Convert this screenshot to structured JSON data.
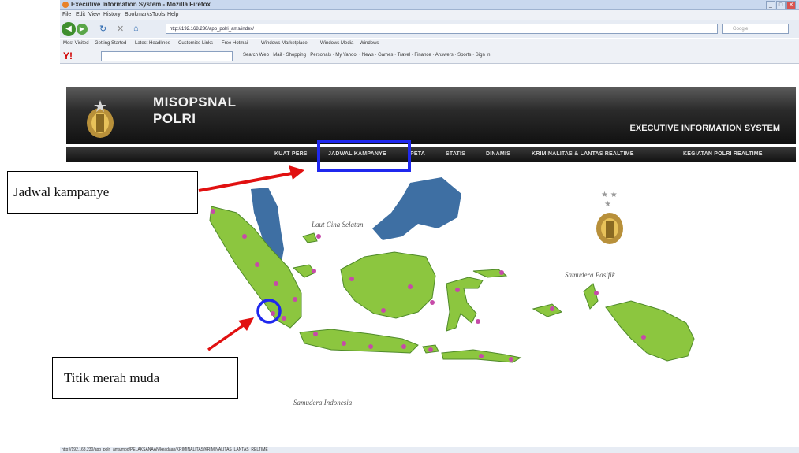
{
  "browser": {
    "title": "Executive Information System - Mozilla Firefox",
    "menu": [
      "File",
      "Edit",
      "View",
      "History",
      "Bookmarks",
      "Tools",
      "Help"
    ],
    "url": "http://192.168.230/app_polri_ams/index/",
    "search_placeholder": "Google",
    "bookmarks": [
      "Most Visited",
      "Getting Started",
      "Latest Headlines",
      "Customize Links",
      "Free Hotmail",
      "Windows Marketplace",
      "Windows Media",
      "Windows"
    ],
    "yahoo_items": "Search Web · Mail · Shopping · Personals · My Yahoo! · News · Games · Travel · Finance · Answers · Sports · Sign In",
    "status_url": "http://192.168.230/app_polri_ams/mod/PELAKSANAAN/keadaan/KRIMINALITAS/KRIMINALITAS_LANTAS_RELTIME"
  },
  "header": {
    "title_line1": "MISOPSNAL",
    "title_line2": "POLRI",
    "subtitle": "EXECUTIVE INFORMATION SYSTEM"
  },
  "nav": {
    "items": [
      "KUAT PERS",
      "JADWAL KAMPANYE",
      "PETA",
      "STATIS",
      "DINAMIS",
      "KRIMINALITAS & LANTAS REALTIME",
      "KEGIATAN POLRI REALTIME"
    ]
  },
  "map": {
    "labels": [
      "Laut Cina Selatan",
      "Samudera Pasifik",
      "Samudera Indonesia"
    ],
    "colors": {
      "land": "#8cc63f",
      "land_dark": "#4f8a2a",
      "sea_fill": "#3e6fa3",
      "marker": "#c64aa8"
    }
  },
  "annotations": {
    "callout1": "Jadwal kampanye",
    "callout2": "Titik merah muda",
    "box_color": "#1f28ee",
    "arrow_color": "#e11010"
  }
}
